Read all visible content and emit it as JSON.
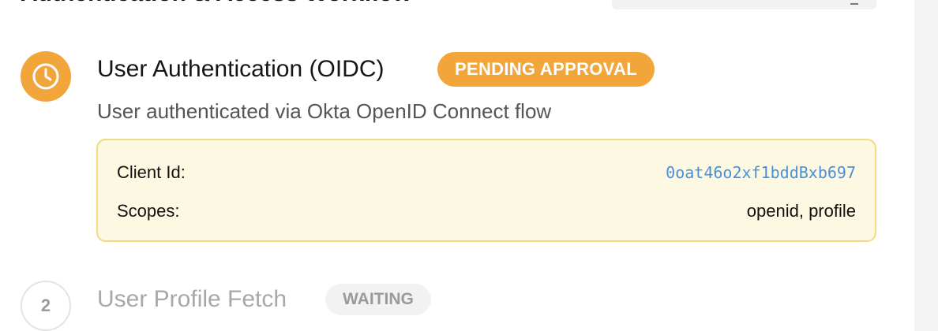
{
  "header": {
    "title": "Authentication & Access Workflow"
  },
  "steps": [
    {
      "title": "User Authentication (OIDC)",
      "status": "PENDING APPROVAL",
      "description": "User authenticated via Okta OpenID Connect flow",
      "icon": "clock-icon",
      "details": [
        {
          "label": "Client Id:",
          "value": "0oat46o2xf1bddBxb697"
        },
        {
          "label": "Scopes:",
          "value": "openid, profile"
        }
      ]
    },
    {
      "number": "2",
      "title": "User Profile Fetch",
      "status": "WAITING"
    }
  ],
  "colors": {
    "pending": "#f2a53b",
    "link": "#4a90d9",
    "card_bg": "#fdf8e1",
    "card_border": "#f2d982",
    "muted": "#a8a8a8"
  }
}
